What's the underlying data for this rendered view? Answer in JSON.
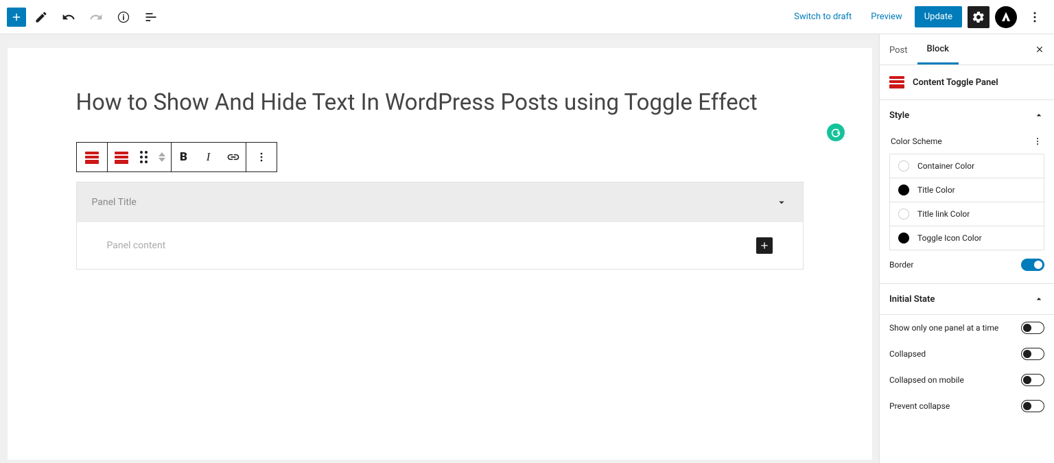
{
  "topbar": {
    "switch_to_draft": "Switch to draft",
    "preview": "Preview",
    "update": "Update"
  },
  "post": {
    "title": "How to Show And Hide Text In WordPress Posts using Toggle Effect",
    "panel_title_placeholder": "Panel Title",
    "panel_content_placeholder": "Panel content"
  },
  "sidebar": {
    "tab_post": "Post",
    "tab_block": "Block",
    "block_name": "Content Toggle Panel",
    "style": {
      "heading": "Style",
      "color_scheme_label": "Color Scheme",
      "colors": {
        "container": "Container Color",
        "title": "Title Color",
        "title_link": "Title link Color",
        "toggle_icon": "Toggle Icon Color"
      },
      "border_label": "Border",
      "border_on": true
    },
    "initial_state": {
      "heading": "Initial State",
      "single_panel": "Show only one panel at a time",
      "collapsed": "Collapsed",
      "collapsed_mobile": "Collapsed on mobile",
      "prevent_collapse": "Prevent collapse"
    }
  }
}
